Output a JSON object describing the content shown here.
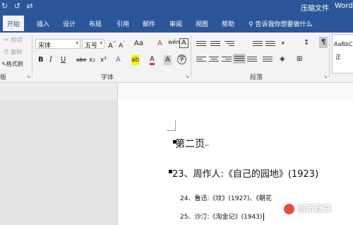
{
  "titlebar": {
    "quick_access": [
      "↻",
      "↺",
      "⇄"
    ],
    "doc_name": "压缩文件",
    "app_name": "Word"
  },
  "tabs": {
    "items": [
      "开始",
      "插入",
      "设计",
      "布局",
      "引用",
      "邮件",
      "审阅",
      "视图",
      "帮助"
    ],
    "active": "开始",
    "tell_me": "告诉我你想要做什么"
  },
  "clipboard": {
    "cut": "剪切",
    "copy": "复制",
    "format_painter": "格式刷",
    "label": "板"
  },
  "font": {
    "name": "宋体",
    "size": "五号",
    "grow": "A",
    "shrink": "A",
    "case": "Aa",
    "clear": "A",
    "phonetic": "wén",
    "border": "A",
    "bold": "B",
    "italic": "I",
    "underline": "U",
    "strike": "abc",
    "subscript": "x₂",
    "superscript": "x²",
    "effects": "A",
    "highlight": "ab",
    "color": "A",
    "shading": "A",
    "enclose": "字",
    "label": "字体"
  },
  "paragraph": {
    "label": "段落",
    "sort": "↕",
    "show_marks": "¶"
  },
  "styles": {
    "sample": "AaBbC",
    "name": "正"
  },
  "document": {
    "line1": "第二页",
    "line2": "23、周作人:《自己的园地》(1923)",
    "line3": "24、鲁迅:《坟》(1927)、《朝花",
    "line4": "25、沙汀:《淘金记》(1943)",
    "return_mark": "↵"
  },
  "watermark": {
    "text": "创新互联"
  }
}
